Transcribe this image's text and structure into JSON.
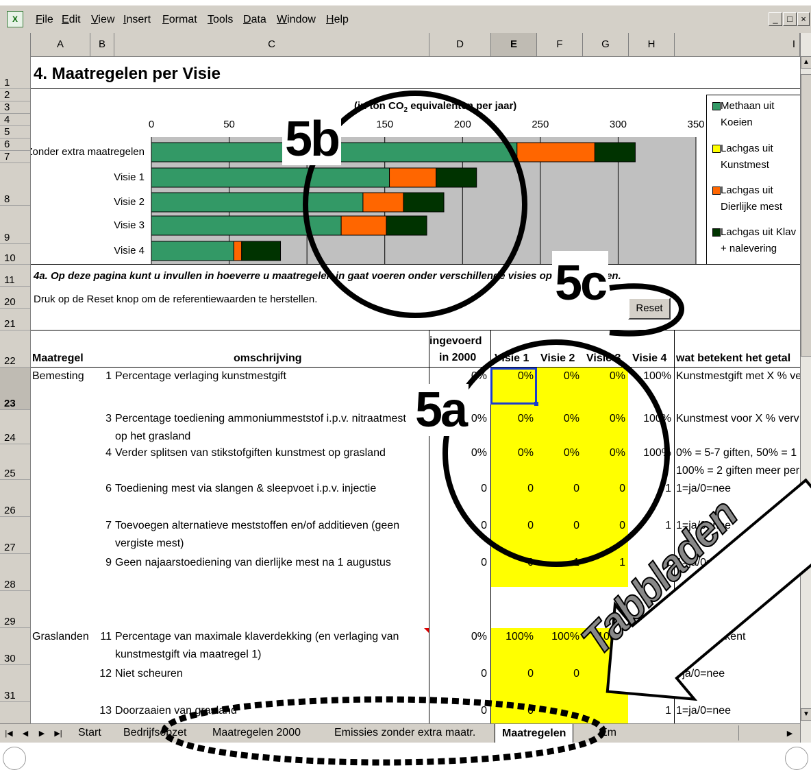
{
  "menu": [
    "File",
    "Edit",
    "View",
    "Insert",
    "Format",
    "Tools",
    "Data",
    "Window",
    "Help"
  ],
  "window_buttons": [
    "_",
    "□",
    "×"
  ],
  "columns": [
    "A",
    "B",
    "C",
    "D",
    "E",
    "F",
    "G",
    "H",
    "I"
  ],
  "rows": [
    "1",
    "2",
    "3",
    "4",
    "5",
    "6",
    "7",
    "8",
    "9",
    "10",
    "11",
    "20",
    "21",
    "22",
    "23",
    "24",
    "25",
    "26",
    "27",
    "28",
    "29",
    "30",
    "31"
  ],
  "title": "4. Maatregelen per Visie",
  "chart_data": {
    "type": "bar",
    "orientation": "horizontal",
    "stacked": true,
    "title": "(in kton CO2 equivalenten per jaar)",
    "title_visible_fragments": [
      "(in",
      "ton CO",
      "2",
      "equiv",
      "alenten per jaar)"
    ],
    "categories": [
      "Zonder extra maatregelen",
      "Visie 1",
      "Visie 2",
      "Visie 3",
      "Visie 4"
    ],
    "xlim": [
      0,
      350
    ],
    "xticks": [
      "0",
      "50",
      "100",
      "150",
      "200",
      "250",
      "300",
      "350"
    ],
    "grid": true,
    "legend_position": "right",
    "series": [
      {
        "name": "Methaan uit Koeien",
        "color": "#339966",
        "values": [
          235,
          153,
          136,
          122,
          53
        ]
      },
      {
        "name": "Lachgas uit Kunstmest",
        "color": "#ffff00",
        "values": [
          0,
          0,
          0,
          0,
          0
        ]
      },
      {
        "name": "Lachgas uit Dierlijke mest",
        "color": "#ff6600",
        "values": [
          50,
          30,
          26,
          29,
          5
        ]
      },
      {
        "name": "Lachgas uit Klaver + nalevering",
        "color": "#003300",
        "values": [
          26,
          26,
          26,
          26,
          25
        ]
      }
    ],
    "legend_visible": [
      [
        "Methaan uit",
        "Koeien"
      ],
      [
        "Lachgas uit",
        "Kunstmest"
      ],
      [
        "Lachgas uit",
        "Dierlijke mest"
      ],
      [
        "Lachgas uit Klav",
        "+ nalevering"
      ]
    ]
  },
  "row11_text": "4a. Op deze pagina kunt u invullen in hoeverre u maatregelen in gaat voeren onder verschillende visies op de tabbladen.",
  "row11_visible": [
    "4a. Op deze pagina kunt u invullen in hoeverre u ma",
    "tregelen in gaat voeren onde",
    "verschill",
    "ligladen."
  ],
  "row20_text": "Druk op de Reset knop om de referentiewaarden te herstellen.",
  "reset_label": "Reset",
  "headers": {
    "maatregel": "Maatregel",
    "omschrijving": "omschrijving",
    "ingevoerd": [
      "ingevoerd",
      "in 2000"
    ],
    "visies": [
      "Visie 1",
      "Visie 2",
      "Visie 3",
      "Visie 4"
    ],
    "wat": "wat betekent het getal"
  },
  "table": [
    {
      "group": "Bemesting",
      "nr": "1",
      "desc": [
        "Percentage verlaging kunstmestgift"
      ],
      "d": "0%",
      "v": [
        "0%",
        "0%",
        "0%",
        "100%"
      ],
      "wat": [
        "Kunstmestgift met X % ve"
      ]
    },
    {
      "group": "",
      "nr": "3",
      "desc": [
        "Percentage toediening ammoniummeststof i.p.v. nitraatmest",
        "op het grasland"
      ],
      "d": "0%",
      "v": [
        "0%",
        "0%",
        "0%",
        "100%"
      ],
      "wat": [
        "Kunstmest voor X % verv"
      ]
    },
    {
      "group": "",
      "nr": "4",
      "desc": [
        "Verder splitsen van stikstofgiften kunstmest op grasland"
      ],
      "d": "0%",
      "v": [
        "0%",
        "0%",
        "0%",
        "100%"
      ],
      "wat": [
        "0% = 5-7 giften, 50% = 1",
        "100% = 2 giften meer per"
      ]
    },
    {
      "group": "",
      "nr": "6",
      "desc": [
        "Toediening mest via slangen & sleepvoet i.p.v. injectie"
      ],
      "d": "0",
      "v": [
        "0",
        "0",
        "0",
        "1"
      ],
      "wat": [
        "1=ja/0=nee"
      ]
    },
    {
      "group": "",
      "nr": "7",
      "desc": [
        "Toevoegen alternatieve meststoffen en/of additieven (geen",
        "vergiste mest)"
      ],
      "d": "0",
      "v": [
        "0",
        "0",
        "0",
        "1"
      ],
      "wat": [
        "1=ja/0=nee"
      ]
    },
    {
      "group": "",
      "nr": "9",
      "desc": [
        "Geen najaarstoediening van dierlijke mest na 1 augustus"
      ],
      "d": "0",
      "v": [
        "0",
        "1",
        "1",
        "1"
      ],
      "wat": [
        "1=ja/0=nee"
      ]
    },
    {
      "group": "Graslanden",
      "nr": "11",
      "desc": [
        "Percentage van maximale klaverdekking (en verlaging van",
        "kunstmestgift via maatregel 1)"
      ],
      "d": "0%",
      "v": [
        "100%",
        "100%",
        "100%",
        ""
      ],
      "wat": [
        "ering betekent"
      ]
    },
    {
      "group": "",
      "nr": "12",
      "desc": [
        "Niet scheuren"
      ],
      "d": "0",
      "v": [
        "0",
        "0",
        "",
        ""
      ],
      "wat": [
        "=ja/0=nee"
      ]
    },
    {
      "group": "",
      "nr": "13",
      "desc": [
        "Doorzaaien van grasland"
      ],
      "d": "0",
      "v": [
        "0",
        "",
        "",
        "1"
      ],
      "wat": [
        "1=ja/0=nee"
      ]
    }
  ],
  "sheet_tabs": [
    "Start",
    "Bedrijfsopzet",
    "Maatregelen 2000",
    "Emissies zonder extra maatr.",
    "Maatregelen",
    "Em"
  ],
  "active_tab": "Maatregelen",
  "annotations": {
    "a": "5a",
    "b": "5b",
    "c": "5c",
    "tabbladen": "Tabbladen"
  }
}
